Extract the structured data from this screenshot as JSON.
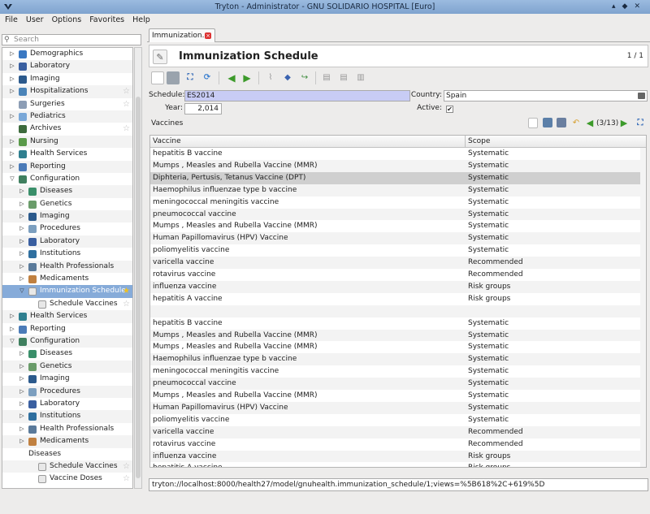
{
  "window": {
    "title": "Tryton - Administrator - GNU SOLIDARIO HOSPITAL [Euro]"
  },
  "menubar": [
    "File",
    "User",
    "Options",
    "Favorites",
    "Help"
  ],
  "sidebar": {
    "search_placeholder": "Search",
    "items": [
      {
        "label": "Demographics",
        "level": 1,
        "expander": "right",
        "icon": "globe-icon",
        "color": "#3a78c2",
        "star": false
      },
      {
        "label": "Laboratory",
        "level": 1,
        "expander": "right",
        "icon": "flask-icon",
        "color": "#3a5fa0",
        "star": false
      },
      {
        "label": "Imaging",
        "level": 1,
        "expander": "right",
        "icon": "xray-icon",
        "color": "#2c5a8c",
        "star": false
      },
      {
        "label": "Hospitalizations",
        "level": 1,
        "expander": "right",
        "icon": "bed-icon",
        "color": "#4b84b8",
        "star": true
      },
      {
        "label": "Surgeries",
        "level": 1,
        "expander": "none",
        "icon": "scalpel-icon",
        "color": "#8c9db5",
        "star": true
      },
      {
        "label": "Pediatrics",
        "level": 1,
        "expander": "right",
        "icon": "baby-icon",
        "color": "#7aa8d8",
        "star": false
      },
      {
        "label": "Archives",
        "level": 1,
        "expander": "none",
        "icon": "archive-icon",
        "color": "#3d6b3d",
        "star": true
      },
      {
        "label": "Nursing",
        "level": 1,
        "expander": "right",
        "icon": "nurse-icon",
        "color": "#5a9a4a",
        "star": false
      },
      {
        "label": "Health Services",
        "level": 1,
        "expander": "right",
        "icon": "services-icon",
        "color": "#2f7f8f",
        "star": false
      },
      {
        "label": "Reporting",
        "level": 1,
        "expander": "right",
        "icon": "report-icon",
        "color": "#4b7bb8",
        "star": false
      },
      {
        "label": "Configuration",
        "level": 1,
        "expander": "down",
        "icon": "config-icon",
        "color": "#3f7f5f",
        "star": false
      },
      {
        "label": "Diseases",
        "level": 2,
        "expander": "right",
        "icon": "disease-icon",
        "color": "#3a8f6a",
        "star": false
      },
      {
        "label": "Genetics",
        "level": 2,
        "expander": "right",
        "icon": "dna-icon",
        "color": "#6a9c6a",
        "star": false
      },
      {
        "label": "Imaging",
        "level": 2,
        "expander": "right",
        "icon": "xray-icon",
        "color": "#2c5a8c",
        "star": false
      },
      {
        "label": "Procedures",
        "level": 2,
        "expander": "right",
        "icon": "procedure-icon",
        "color": "#7c9fbf",
        "star": false
      },
      {
        "label": "Laboratory",
        "level": 2,
        "expander": "right",
        "icon": "flask-icon",
        "color": "#3a5fa0",
        "star": false
      },
      {
        "label": "Institutions",
        "level": 2,
        "expander": "right",
        "icon": "building-icon",
        "color": "#2f6f9f",
        "star": false
      },
      {
        "label": "Health Professionals",
        "level": 2,
        "expander": "right",
        "icon": "doctor-icon",
        "color": "#5a7a9a",
        "star": false
      },
      {
        "label": "Medicaments",
        "level": 2,
        "expander": "right",
        "icon": "pill-icon",
        "color": "#c08040",
        "star": false
      },
      {
        "label": "Immunization Schedule",
        "level": 2,
        "expander": "down",
        "icon": "document-icon",
        "color": "#e8e8e8",
        "star": true,
        "selected": true
      },
      {
        "label": "Schedule Vaccines",
        "level": 3,
        "expander": "none",
        "icon": "document-icon",
        "color": "#e8e8e8",
        "star": true
      },
      {
        "label": "Health Services",
        "level": 1,
        "expander": "right",
        "icon": "services-icon",
        "color": "#2f7f8f",
        "star": false
      },
      {
        "label": "Reporting",
        "level": 1,
        "expander": "right",
        "icon": "report-icon",
        "color": "#4b7bb8",
        "star": false
      },
      {
        "label": "Configuration",
        "level": 1,
        "expander": "down",
        "icon": "config-icon",
        "color": "#3f7f5f",
        "star": false
      },
      {
        "label": "Diseases",
        "level": 2,
        "expander": "right",
        "icon": "disease-icon",
        "color": "#3a8f6a",
        "star": false
      },
      {
        "label": "Genetics",
        "level": 2,
        "expander": "right",
        "icon": "dna-icon",
        "color": "#6a9c6a",
        "star": false
      },
      {
        "label": "Imaging",
        "level": 2,
        "expander": "right",
        "icon": "xray-icon",
        "color": "#2c5a8c",
        "star": false
      },
      {
        "label": "Procedures",
        "level": 2,
        "expander": "right",
        "icon": "procedure-icon",
        "color": "#7c9fbf",
        "star": false
      },
      {
        "label": "Laboratory",
        "level": 2,
        "expander": "right",
        "icon": "flask-icon",
        "color": "#3a5fa0",
        "star": false
      },
      {
        "label": "Institutions",
        "level": 2,
        "expander": "right",
        "icon": "building-icon",
        "color": "#2f6f9f",
        "star": false
      },
      {
        "label": "Health Professionals",
        "level": 2,
        "expander": "right",
        "icon": "doctor-icon",
        "color": "#5a7a9a",
        "star": false
      },
      {
        "label": "Medicaments",
        "level": 2,
        "expander": "right",
        "icon": "pill-icon",
        "color": "#c08040",
        "star": false
      },
      {
        "label": "Diseases",
        "level": 2,
        "expander": "none",
        "icon": "none",
        "color": "",
        "star": false
      },
      {
        "label": "Schedule Vaccines",
        "level": 3,
        "expander": "none",
        "icon": "document-icon",
        "color": "#e8e8e8",
        "star": true
      },
      {
        "label": "Vaccine Doses",
        "level": 3,
        "expander": "none",
        "icon": "document-icon",
        "color": "#e8e8e8",
        "star": true
      }
    ]
  },
  "tab": {
    "label": "Immunization..."
  },
  "header": {
    "title": "Immunization Schedule",
    "page": "1 / 1"
  },
  "form": {
    "schedule_label": "Schedule:",
    "schedule_value": "ES2014",
    "country_label": "Country:",
    "country_value": "Spain",
    "year_label": "Year:",
    "year_value": "2,014",
    "active_label": "Active:",
    "active_checked": true
  },
  "vaccines": {
    "title": "Vaccines",
    "count": "(3/13)",
    "columns": [
      "Vaccine",
      "Scope"
    ],
    "rows": [
      {
        "vaccine": "hepatitis B vaccine",
        "scope": "Systematic"
      },
      {
        "vaccine": "Mumps , Measles and Rubella Vaccine (MMR)",
        "scope": "Systematic"
      },
      {
        "vaccine": "Diphteria, Pertusis, Tetanus Vaccine (DPT)",
        "scope": "Systematic",
        "selected": true
      },
      {
        "vaccine": "Haemophilus influenzae type b vaccine",
        "scope": "Systematic"
      },
      {
        "vaccine": "meningococcal meningitis vaccine",
        "scope": "Systematic"
      },
      {
        "vaccine": "pneumococcal vaccine",
        "scope": "Systematic"
      },
      {
        "vaccine": "Mumps , Measles and Rubella Vaccine (MMR)",
        "scope": "Systematic"
      },
      {
        "vaccine": "Human Papillomavirus (HPV) Vaccine",
        "scope": "Systematic"
      },
      {
        "vaccine": "poliomyelitis vaccine",
        "scope": "Systematic"
      },
      {
        "vaccine": "varicella vaccine",
        "scope": "Recommended"
      },
      {
        "vaccine": "rotavirus vaccine",
        "scope": "Recommended"
      },
      {
        "vaccine": "influenza vaccine",
        "scope": "Risk groups"
      },
      {
        "vaccine": "hepatitis A vaccine",
        "scope": "Risk groups"
      },
      {
        "vaccine": "",
        "scope": ""
      },
      {
        "vaccine": "hepatitis B vaccine",
        "scope": "Systematic"
      },
      {
        "vaccine": "Mumps , Measles and Rubella Vaccine (MMR)",
        "scope": "Systematic"
      },
      {
        "vaccine": "Mumps , Measles and Rubella Vaccine (MMR)",
        "scope": "Systematic"
      },
      {
        "vaccine": "Haemophilus influenzae type b vaccine",
        "scope": "Systematic"
      },
      {
        "vaccine": "meningococcal meningitis vaccine",
        "scope": "Systematic"
      },
      {
        "vaccine": "pneumococcal vaccine",
        "scope": "Systematic"
      },
      {
        "vaccine": "Mumps , Measles and Rubella Vaccine (MMR)",
        "scope": "Systematic"
      },
      {
        "vaccine": "Human Papillomavirus (HPV) Vaccine",
        "scope": "Systematic"
      },
      {
        "vaccine": "poliomyelitis vaccine",
        "scope": "Systematic"
      },
      {
        "vaccine": "varicella vaccine",
        "scope": "Recommended"
      },
      {
        "vaccine": "rotavirus vaccine",
        "scope": "Recommended"
      },
      {
        "vaccine": "influenza vaccine",
        "scope": "Risk groups"
      },
      {
        "vaccine": "hepatitis A vaccine",
        "scope": "Risk groups"
      }
    ]
  },
  "statusbar": {
    "url": "tryton://localhost:8000/health27/model/gnuhealth.immunization_schedule/1;views=%5B618%2C+619%5D"
  },
  "colors": {
    "titlebar": "#8fb0d8",
    "selection": "#86abd9",
    "schedule_field": "#c8ccf5"
  }
}
